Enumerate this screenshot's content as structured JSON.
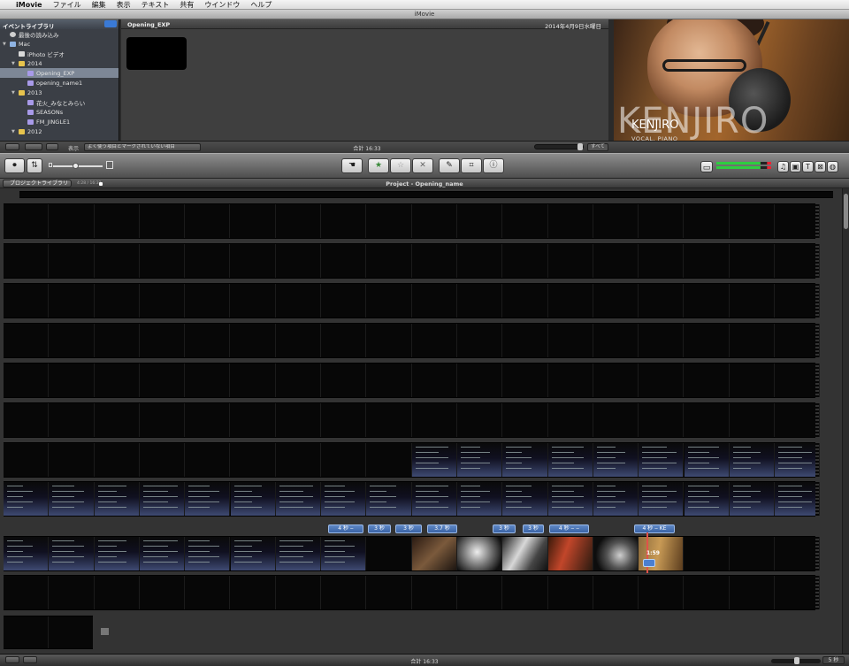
{
  "menubar": {
    "app": "iMovie",
    "items": [
      "ファイル",
      "編集",
      "表示",
      "テキスト",
      "共有",
      "ウインドウ",
      "ヘルプ"
    ]
  },
  "window": {
    "title": "iMovie"
  },
  "event_library": {
    "title": "イベントライブラリ",
    "items": [
      {
        "label": "最後の読み込み",
        "icon": "clock-icon",
        "level": 0
      },
      {
        "label": "Mac",
        "icon": "computer-icon",
        "level": 0,
        "expanded": true
      },
      {
        "label": "iPhoto ビデオ",
        "icon": "photo-icon",
        "level": 1
      },
      {
        "label": "2014",
        "icon": "folder-icon",
        "level": 1,
        "expanded": true
      },
      {
        "label": "Opening_EXP",
        "icon": "event-star-icon",
        "level": 2,
        "selected": true
      },
      {
        "label": "opening_name1",
        "icon": "event-star-icon",
        "level": 2
      },
      {
        "label": "2013",
        "icon": "folder-icon",
        "level": 1,
        "expanded": true
      },
      {
        "label": "花火_みなとみらい",
        "icon": "event-star-icon",
        "level": 2
      },
      {
        "label": "SEASONs",
        "icon": "event-star-icon",
        "level": 2
      },
      {
        "label": "FM_JINGLE1",
        "icon": "event-star-icon",
        "level": 2
      },
      {
        "label": "2012",
        "icon": "folder-icon",
        "level": 1,
        "expanded": true
      }
    ]
  },
  "event_browser": {
    "event_name": "Opening_EXP",
    "date": "2014年4月9日水曜日",
    "filter_label": "表示",
    "filter_value": "よく使う項目とマークされていない項目",
    "total": "合計 16:33",
    "show_all": "すべて"
  },
  "viewer": {
    "title_big": "KENJIRO",
    "title_small": "KENJIRO",
    "subtitle": "VOCAL, PIANO"
  },
  "toolbar": {
    "icons": [
      "camera-icon",
      "swap-icon",
      "select-icon",
      "favorite-star-icon",
      "unfavorite-star-icon",
      "reject-x-icon",
      "eyedropper-icon",
      "crop-icon",
      "info-icon",
      "voiceover-icon",
      "music-icon",
      "photo-icon",
      "title-icon",
      "transition-icon",
      "map-icon"
    ]
  },
  "project": {
    "library_button": "プロジェクトライブラリ",
    "counter": "4:28 / 16:33",
    "title": "Project - Opening_name"
  },
  "clips": {
    "durations": [
      "4 秒 ‒",
      "3 秒",
      "3 秒",
      "3.7 秒",
      "3 秒",
      "3 秒",
      "4 秒 ‒ ‒",
      "4 秒 ‒ KE"
    ],
    "playhead_time": "1:59"
  },
  "status": {
    "total": "合計 16:33",
    "seconds": "5 秒"
  }
}
